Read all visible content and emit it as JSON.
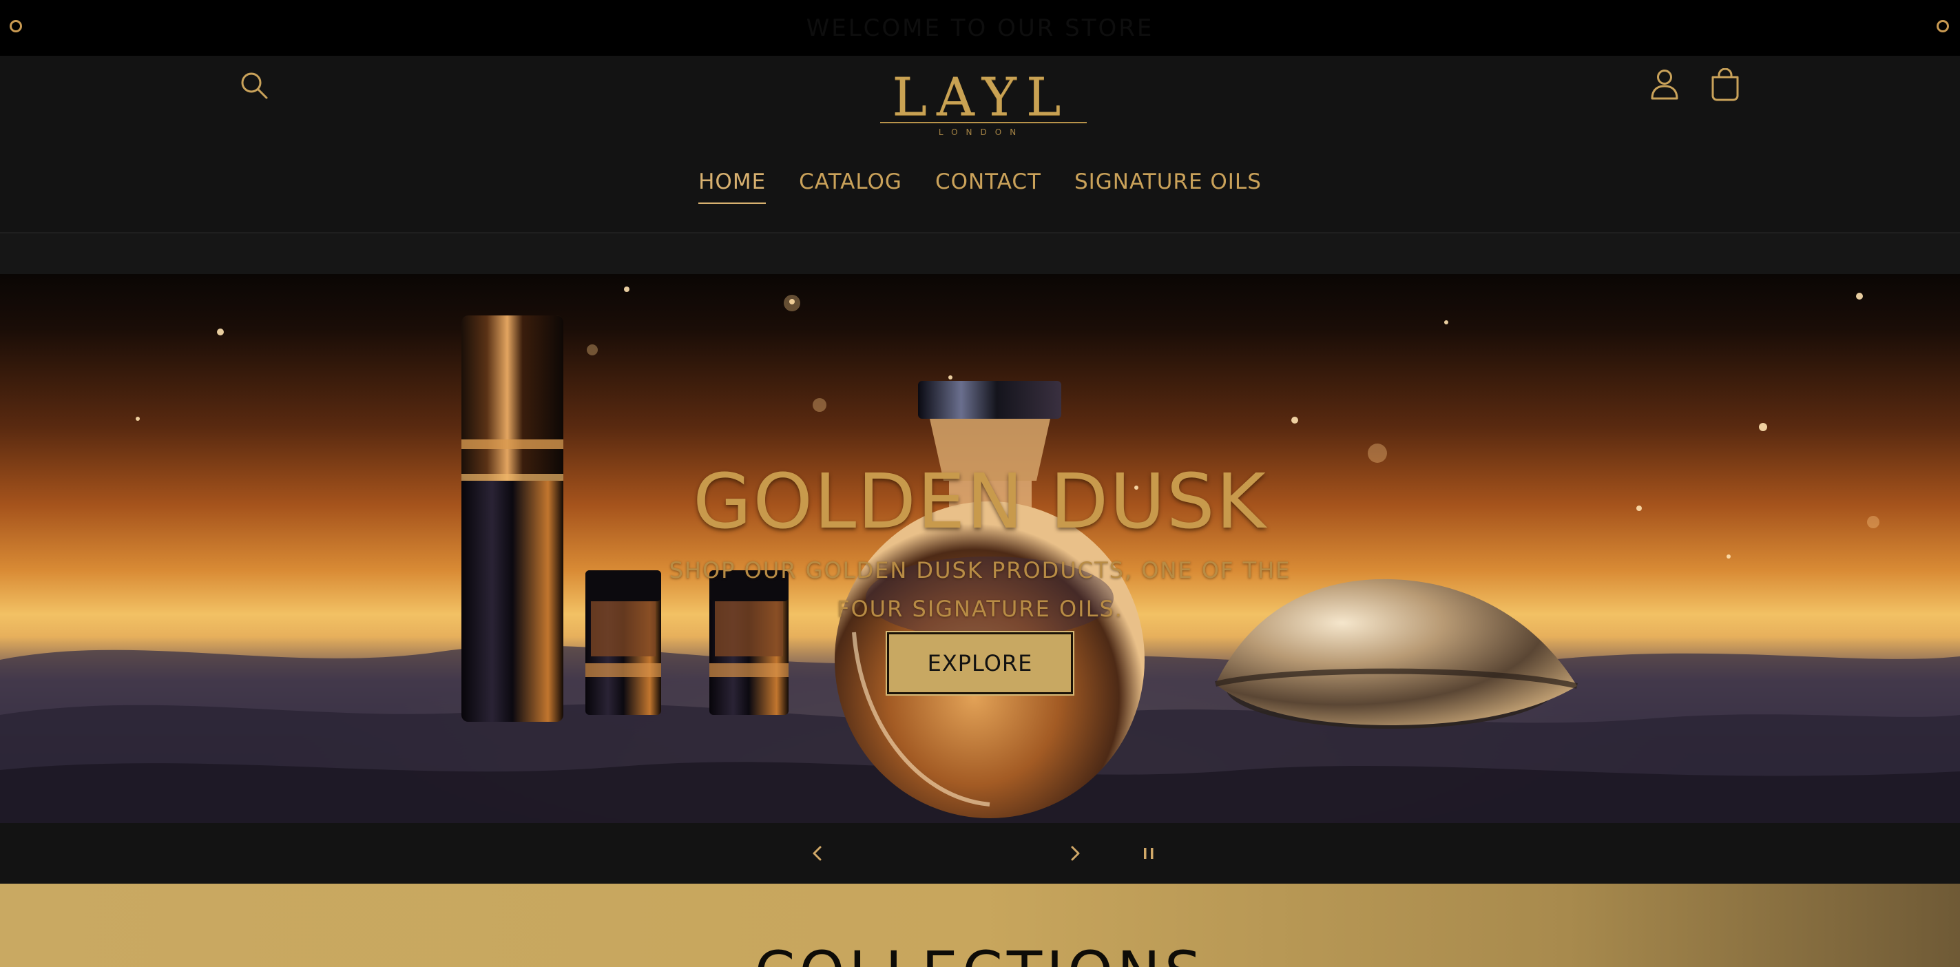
{
  "announcement": {
    "text": "WELCOME TO OUR STORE"
  },
  "header": {
    "logo_text": "LAYL",
    "logo_subtext": "LONDON",
    "icons": {
      "search": "search-icon",
      "account": "user-icon",
      "cart": "bag-icon"
    }
  },
  "nav": {
    "items": [
      {
        "label": "HOME",
        "active": true
      },
      {
        "label": "CATALOG",
        "active": false
      },
      {
        "label": "CONTACT",
        "active": false
      },
      {
        "label": "SIGNATURE OILS",
        "active": false
      }
    ]
  },
  "hero": {
    "title": "GOLDEN DUSK",
    "subtitle": "SHOP OUR GOLDEN DUSK PRODUCTS, ONE OF THE FOUR SIGNATURE OILS.",
    "button_label": "EXPLORE"
  },
  "slider_controls": {
    "prev_icon": "chevron-left-icon",
    "next_icon": "chevron-right-icon",
    "pause_icon": "pause-icon"
  },
  "collections": {
    "title": "COLLECTIONS"
  },
  "colors": {
    "gold": "#c9a253",
    "header_bg": "#131313",
    "announce_bg": "#000000"
  }
}
